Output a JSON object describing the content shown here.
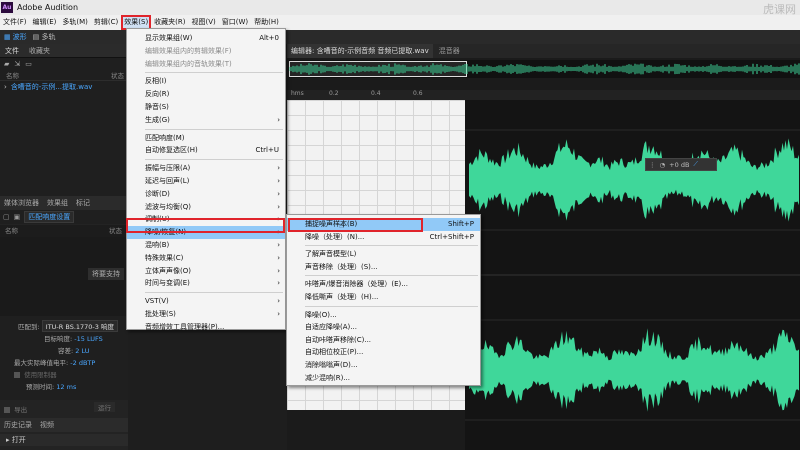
{
  "app": {
    "logo": "Au",
    "title": "Adobe Audition",
    "watermark": "虎课网"
  },
  "menubar": [
    "文件(F)",
    "编辑(E)",
    "多轨(M)",
    "剪辑(C)",
    "效果(S)",
    "收藏夹(R)",
    "视图(V)",
    "窗口(W)",
    "帮助(H)"
  ],
  "toolbar": {
    "waveform": "波形",
    "multitrack": "多轨"
  },
  "files_panel": {
    "tabs": [
      "文件",
      "收藏夹"
    ],
    "col_name": "名称",
    "col_status": "状态",
    "file": "含嘈音的-示例...提取.wav"
  },
  "media_panel": {
    "tabs": [
      "媒体浏览器",
      "效果组",
      "标记"
    ],
    "match_btn": "匹配响度设置",
    "col_name": "名称",
    "col_status": "状态",
    "support": "将要支持"
  },
  "match": {
    "match_label": "匹配到:",
    "match_value": "ITU-R BS.1770-3 响度",
    "target_label": "目标响度:",
    "target_value": "-15 LUFS",
    "tolerance_label": "容差:",
    "tolerance_value": "2 LU",
    "peak_label": "最大实际峰值电平:",
    "peak_value": "-2 dBTP",
    "limit_label": "使用限制器",
    "lookahead_label": "预测时间:",
    "lookahead_value": "12 ms",
    "export_label": "导出",
    "run_label": "运行"
  },
  "history_panel": {
    "tabs": [
      "历史记录",
      "视频"
    ],
    "row": "打开"
  },
  "editor": {
    "tab": "编辑器: 含嘈音的-示例音频 音频已提取.wav",
    "tab2": "混音器",
    "ruler": [
      "hms",
      "0.2",
      "0.4",
      "0.6"
    ],
    "hud_value": "+0 dB"
  },
  "effects_menu": [
    {
      "label": "显示效果组(W)",
      "shortcut": "Alt+0"
    },
    {
      "label": "编辑效果组内的剪辑效果(F)",
      "disabled": true
    },
    {
      "label": "编辑效果组内的音轨效果(T)",
      "disabled": true
    },
    {
      "sep": true
    },
    {
      "label": "反相(I)"
    },
    {
      "label": "反向(R)"
    },
    {
      "label": "静音(S)"
    },
    {
      "label": "生成(G)",
      "submenu": true
    },
    {
      "sep": true
    },
    {
      "label": "匹配响度(M)"
    },
    {
      "label": "自动修复选区(H)",
      "shortcut": "Ctrl+U"
    },
    {
      "sep": true
    },
    {
      "label": "振幅与压限(A)",
      "submenu": true
    },
    {
      "label": "延迟与回声(L)",
      "submenu": true
    },
    {
      "label": "诊断(D)",
      "submenu": true
    },
    {
      "label": "滤波与均衡(Q)",
      "submenu": true
    },
    {
      "label": "调制(U)",
      "submenu": true
    },
    {
      "label": "降噪/恢复(N)",
      "submenu": true,
      "highlight": true
    },
    {
      "label": "混响(B)",
      "submenu": true
    },
    {
      "label": "特殊效果(C)",
      "submenu": true
    },
    {
      "label": "立体声声像(O)",
      "submenu": true
    },
    {
      "label": "时间与变调(E)",
      "submenu": true
    },
    {
      "sep": true
    },
    {
      "label": "VST(V)",
      "submenu": true
    },
    {
      "label": "批处理(S)",
      "submenu": true
    },
    {
      "label": "音频增效工具管理器(P)..."
    }
  ],
  "noise_menu": [
    {
      "label": "捕捉噪声样本(B)",
      "shortcut": "Shift+P",
      "highlight": true
    },
    {
      "label": "降噪（处理）(N)...",
      "shortcut": "Ctrl+Shift+P"
    },
    {
      "sep": true
    },
    {
      "label": "了解声音模型(L)"
    },
    {
      "label": "声音移除（处理）(S)..."
    },
    {
      "sep": true
    },
    {
      "label": "咔嗒声/爆音消除器（处理）(E)..."
    },
    {
      "label": "降低嘶声（处理）(H)..."
    },
    {
      "sep": true
    },
    {
      "label": "降噪(O)..."
    },
    {
      "label": "自适应降噪(A)..."
    },
    {
      "label": "自动咔嗒声移除(C)..."
    },
    {
      "label": "自动相位校正(P)..."
    },
    {
      "label": "消除嗡嗡声(D)..."
    },
    {
      "label": "减少混响(R)..."
    }
  ],
  "colors": {
    "waveform": "#3fd79a",
    "accent": "#4aa7ff",
    "menu_highlight": "#91c9f7",
    "red_outline": "#e0242b"
  }
}
